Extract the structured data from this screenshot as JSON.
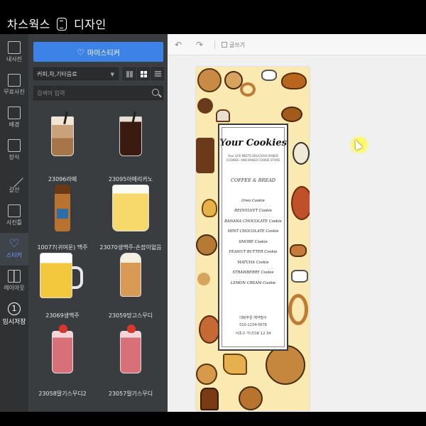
{
  "app": {
    "title_left": "차스웍스",
    "title_right": "디자인"
  },
  "rail": [
    {
      "key": "background_img",
      "label": "내사진"
    },
    {
      "key": "free_photos",
      "label": "무료사진"
    },
    {
      "key": "background",
      "label": "배경"
    },
    {
      "key": "decor",
      "label": "장식"
    },
    {
      "key": "line",
      "label": "갈선"
    },
    {
      "key": "photo_frame",
      "label": "사진틀"
    },
    {
      "key": "sticker",
      "label": "스티커"
    },
    {
      "key": "layout",
      "label": "레이아웃"
    },
    {
      "key": "temp_save",
      "label": "임시저장"
    }
  ],
  "panel": {
    "my_sticker_button": "마이스티커",
    "category": "커피,차,기타음료",
    "search_placeholder": "검색어 입력"
  },
  "stickers": [
    {
      "caption": "23096라떼",
      "kind": "latte"
    },
    {
      "caption": "23095아메리카노",
      "kind": "americano"
    },
    {
      "caption": "10077(귀여운) 맥주",
      "kind": "bottle"
    },
    {
      "caption": "23070생맥주-손잡이없음",
      "kind": "beer-glass"
    },
    {
      "caption": "23069생맥주",
      "kind": "mug"
    },
    {
      "caption": "23059망고스무디",
      "kind": "smoothie"
    },
    {
      "caption": "23058딸기스무디2",
      "kind": "strawberry"
    },
    {
      "caption": "23057딸기스무디",
      "kind": "strawberry"
    }
  ],
  "toolbar": {
    "textbox_label": "글쓰기"
  },
  "poster": {
    "title": "Your Cookies",
    "subtitle": "Your LIFE MEETS DELICIOUS BAKED COOKIES. AND BAKED COOKIE STORE",
    "section": "COFFEE & BREAD",
    "items": [
      "Oreo Cookie",
      "REDVELVET Cookie",
      "BANANA CHOCOLATE Cookie",
      "MINT CHOCOLATE Cookie",
      "SMORE Cookie",
      "PEANUT BUTTER Cookie",
      "MATCHA Cookie",
      "STRAWBERRY Cookie",
      "LEMON CREAM Cookie"
    ],
    "footer": [
      "대랑주문 예약필수",
      "010-1234-5678",
      "서초구 가나다로 12-34"
    ]
  },
  "colors": {
    "accent": "#3d82e6",
    "panel": "#3a3d40",
    "rail": "#2f3133",
    "poster_bg": "#fae9b1"
  }
}
